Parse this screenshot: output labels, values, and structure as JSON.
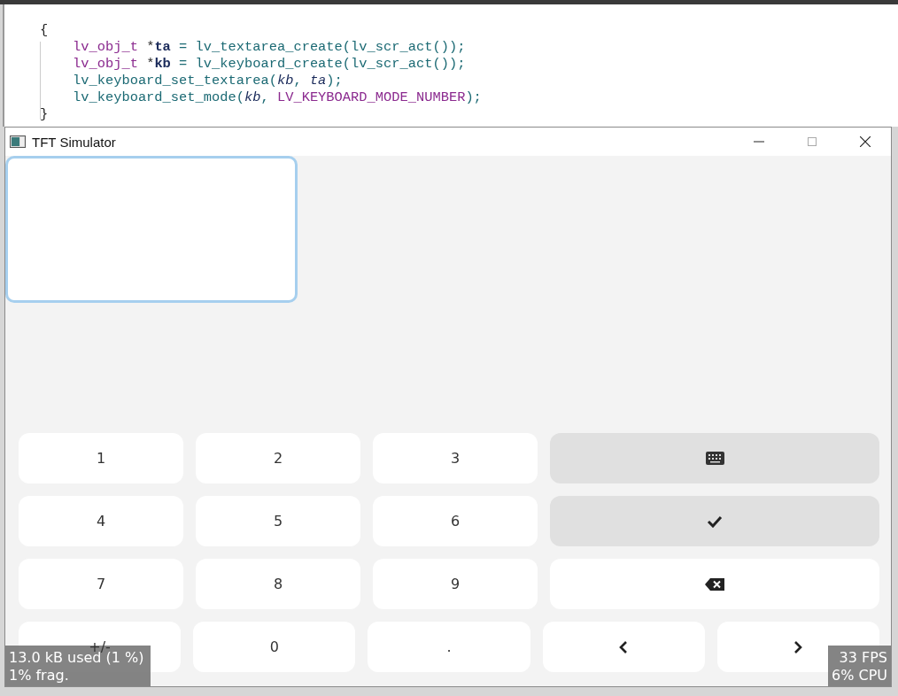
{
  "code_lines": [
    {
      "indented": false,
      "tokens": [
        {
          "text": "{",
          "kind": "punct"
        }
      ]
    },
    {
      "indented": true,
      "tokens": [
        {
          "text": "lv_obj_t",
          "kind": "type"
        },
        {
          "text": " *",
          "kind": "punct"
        },
        {
          "text": "ta",
          "kind": "var"
        },
        {
          "text": " = ",
          "kind": "op"
        },
        {
          "text": "lv_textarea_create(lv_scr_act());",
          "kind": "func"
        }
      ]
    },
    {
      "indented": true,
      "tokens": [
        {
          "text": "lv_obj_t",
          "kind": "type"
        },
        {
          "text": " *",
          "kind": "punct"
        },
        {
          "text": "kb",
          "kind": "var"
        },
        {
          "text": " = ",
          "kind": "op"
        },
        {
          "text": "lv_keyboard_create(lv_scr_act());",
          "kind": "func"
        }
      ]
    },
    {
      "indented": true,
      "tokens": [
        {
          "text": "lv_keyboard_set_textarea(",
          "kind": "func"
        },
        {
          "text": "kb",
          "kind": "param"
        },
        {
          "text": ", ",
          "kind": "func"
        },
        {
          "text": "ta",
          "kind": "param"
        },
        {
          "text": ");",
          "kind": "func"
        }
      ]
    },
    {
      "indented": true,
      "tokens": [
        {
          "text": "lv_keyboard_set_mode(",
          "kind": "func"
        },
        {
          "text": "kb",
          "kind": "param"
        },
        {
          "text": ", ",
          "kind": "func"
        },
        {
          "text": "LV_KEYBOARD_MODE_NUMBER",
          "kind": "macro"
        },
        {
          "text": ");",
          "kind": "func"
        }
      ]
    },
    {
      "indented": false,
      "tokens": [
        {
          "text": "}",
          "kind": "punct"
        }
      ]
    }
  ],
  "window": {
    "title": "TFT Simulator"
  },
  "textarea": {
    "focused": true
  },
  "keyboard": {
    "rows": [
      [
        {
          "kind": "text",
          "label": "1",
          "highlighted": false
        },
        {
          "kind": "text",
          "label": "2",
          "highlighted": false
        },
        {
          "kind": "text",
          "label": "3",
          "highlighted": false
        },
        {
          "kind": "keyboard",
          "highlighted": true
        }
      ],
      [
        {
          "kind": "text",
          "label": "4",
          "highlighted": false
        },
        {
          "kind": "text",
          "label": "5",
          "highlighted": false
        },
        {
          "kind": "text",
          "label": "6",
          "highlighted": false
        },
        {
          "kind": "ok",
          "highlighted": true
        }
      ],
      [
        {
          "kind": "text",
          "label": "7",
          "highlighted": false
        },
        {
          "kind": "text",
          "label": "8",
          "highlighted": false
        },
        {
          "kind": "text",
          "label": "9",
          "highlighted": false
        },
        {
          "kind": "backspace",
          "highlighted": false
        }
      ],
      [
        {
          "kind": "text",
          "label": "+/-",
          "highlighted": false
        },
        {
          "kind": "text",
          "label": "0",
          "highlighted": false
        },
        {
          "kind": "text",
          "label": ".",
          "highlighted": false
        },
        {
          "kind": "left",
          "highlighted": false
        },
        {
          "kind": "right",
          "highlighted": false
        }
      ]
    ]
  },
  "memory_monitor": [
    "13.0 kB used (1 %)",
    "1% frag."
  ],
  "performance_monitor": [
    "33 FPS",
    "6% CPU"
  ]
}
